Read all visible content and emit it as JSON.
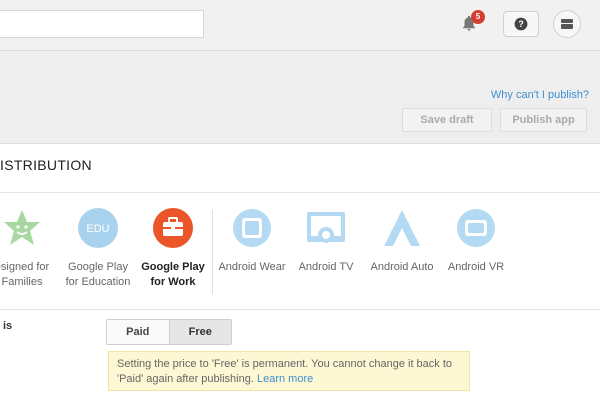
{
  "topbar": {
    "search_value": "",
    "notification_count": "5",
    "icons": [
      "bell-icon",
      "help-icon",
      "account-icon"
    ]
  },
  "header": {
    "why_link": "Why can't I publish?",
    "save_draft_label": "Save draft",
    "publish_label": "Publish app"
  },
  "distribution": {
    "title": "ISTRIBUTION",
    "items": [
      {
        "line1": "esigned for",
        "line2": "Families",
        "icon": "families-star-icon",
        "color": "#a9d7a1"
      },
      {
        "line1": "Google Play",
        "line2": "for Education",
        "icon": "edu-icon",
        "color": "#a9d2ee"
      },
      {
        "line1": "Google Play",
        "line2": "for Work",
        "icon": "briefcase-icon",
        "color": "#ea5627"
      },
      {
        "line1": "Android Wear",
        "line2": "",
        "icon": "watch-icon",
        "color": "#b3daf2"
      },
      {
        "line1": "Android TV",
        "line2": "",
        "icon": "tv-icon",
        "color": "#b3daf2"
      },
      {
        "line1": "Android Auto",
        "line2": "",
        "icon": "auto-icon",
        "color": "#b3daf2"
      },
      {
        "line1": "Android VR",
        "line2": "",
        "icon": "vr-icon",
        "color": "#b3daf2"
      }
    ],
    "edu_badge": "EDU"
  },
  "pricing": {
    "row_label": "is",
    "paid_label": "Paid",
    "free_label": "Free",
    "selected": "Free",
    "notice_text": "Setting the price to 'Free' is permanent. You cannot change it back to 'Paid' again after publishing.",
    "learn_more": "Learn more"
  }
}
